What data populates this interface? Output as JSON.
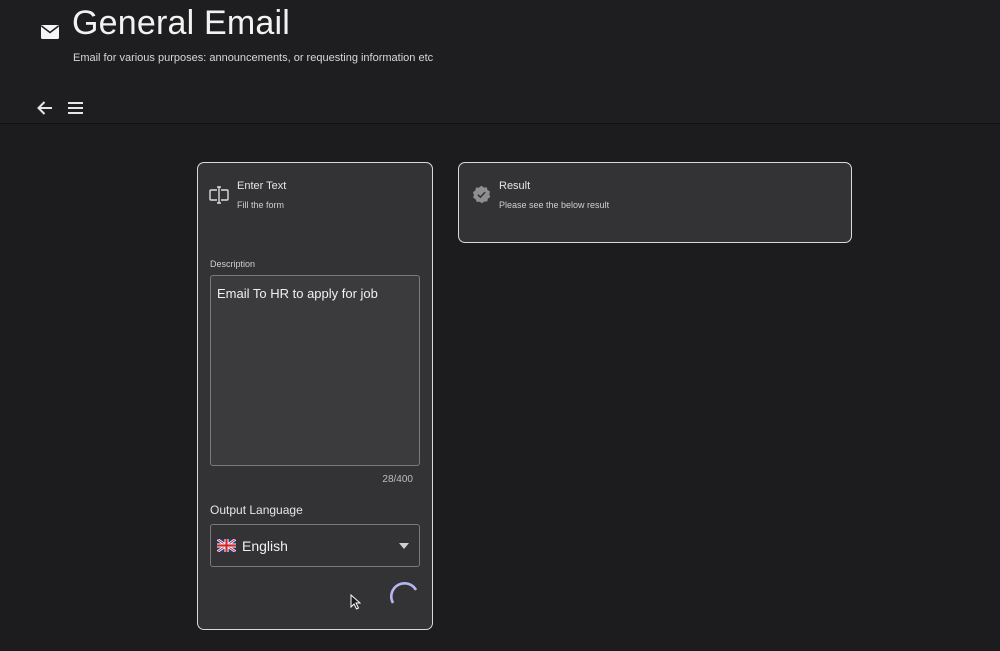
{
  "header": {
    "title": "General Email",
    "subtitle": "Email for various purposes: announcements, or requesting information etc",
    "icon": "mail-icon"
  },
  "nav": {
    "back_icon": "arrow-left-icon",
    "menu_icon": "menu-icon"
  },
  "input_card": {
    "title": "Enter Text",
    "subtitle": "Fill the form",
    "icon": "text-cursor-icon",
    "description_label": "Description",
    "description_value": "Email To HR to apply for job",
    "counter": "28/400",
    "language_label": "Output Language",
    "language_value": "English",
    "language_flag": "uk-flag-icon",
    "status": "loading"
  },
  "result_card": {
    "title": "Result",
    "subtitle": "Please see the below result",
    "icon": "check-badge-icon"
  },
  "colors": {
    "background": "#1c1c1e",
    "card": "#333335",
    "card_border": "#d9d9dc",
    "spinner": "#b7b5f0"
  }
}
